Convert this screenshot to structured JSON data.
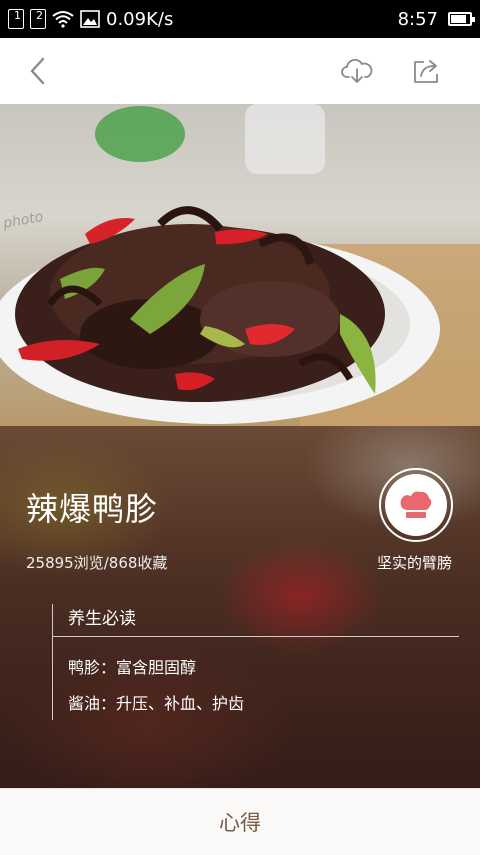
{
  "status_bar": {
    "sim1": "1",
    "sim2": "2",
    "network_speed": "0.09K/s",
    "time": "8:57",
    "battery_level": 0.85
  },
  "toolbar": {
    "back_icon": "chevron-left-icon",
    "download_icon": "cloud-download-icon",
    "share_icon": "share-icon"
  },
  "hero": {
    "watermark": "photo"
  },
  "recipe": {
    "title": "辣爆鸭胗",
    "stats": "25895浏览/868收藏",
    "author_name": "坚实的臂膀"
  },
  "tips": {
    "header": "养生必读",
    "items": [
      "鸭胗：富含胆固醇",
      "酱油：升压、补血、护齿"
    ]
  },
  "bottom": {
    "label": "心得"
  },
  "colors": {
    "accent": "#e9686d",
    "bottom_text": "#7a5a44"
  }
}
